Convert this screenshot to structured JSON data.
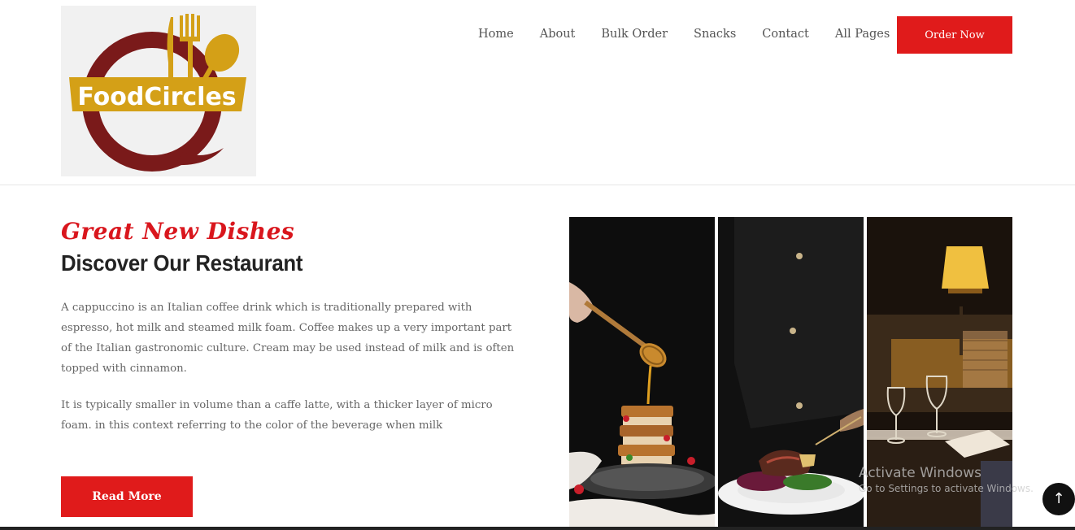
{
  "brand": {
    "name": "FoodCircles"
  },
  "nav": {
    "items": [
      "Home",
      "About",
      "Bulk Order",
      "Snacks",
      "Contact",
      "All Pages"
    ],
    "cta_label": "Order Now"
  },
  "hero": {
    "script_title": "Great New Dishes",
    "title": "Discover Our Restaurant",
    "paragraphs": [
      "A cappuccino is an Italian coffee drink which is traditionally prepared with espresso, hot milk and steamed milk foam. Coffee makes up a very important part of the Italian gastronomic culture. Cream may be used instead of milk and is often topped with cinnamon.",
      "It is typically smaller in volume than a caffe latte, with a thicker layer of micro foam. in this context referring to the color of the beverage when milk"
    ],
    "button_label": "Read More"
  },
  "gallery": {
    "photos": [
      "honey-stack-photo",
      "plated-steak-photo",
      "restaurant-interior-photo"
    ]
  },
  "watermark": {
    "title": "Activate Windows",
    "subtitle": "Go to Settings to activate Windows."
  },
  "scroll_top": {
    "icon": "arrow-up-icon",
    "glyph": "↑"
  },
  "colors": {
    "accent": "#e01b1b",
    "logo_red": "#7a1a1a",
    "logo_gold": "#d4a017"
  }
}
